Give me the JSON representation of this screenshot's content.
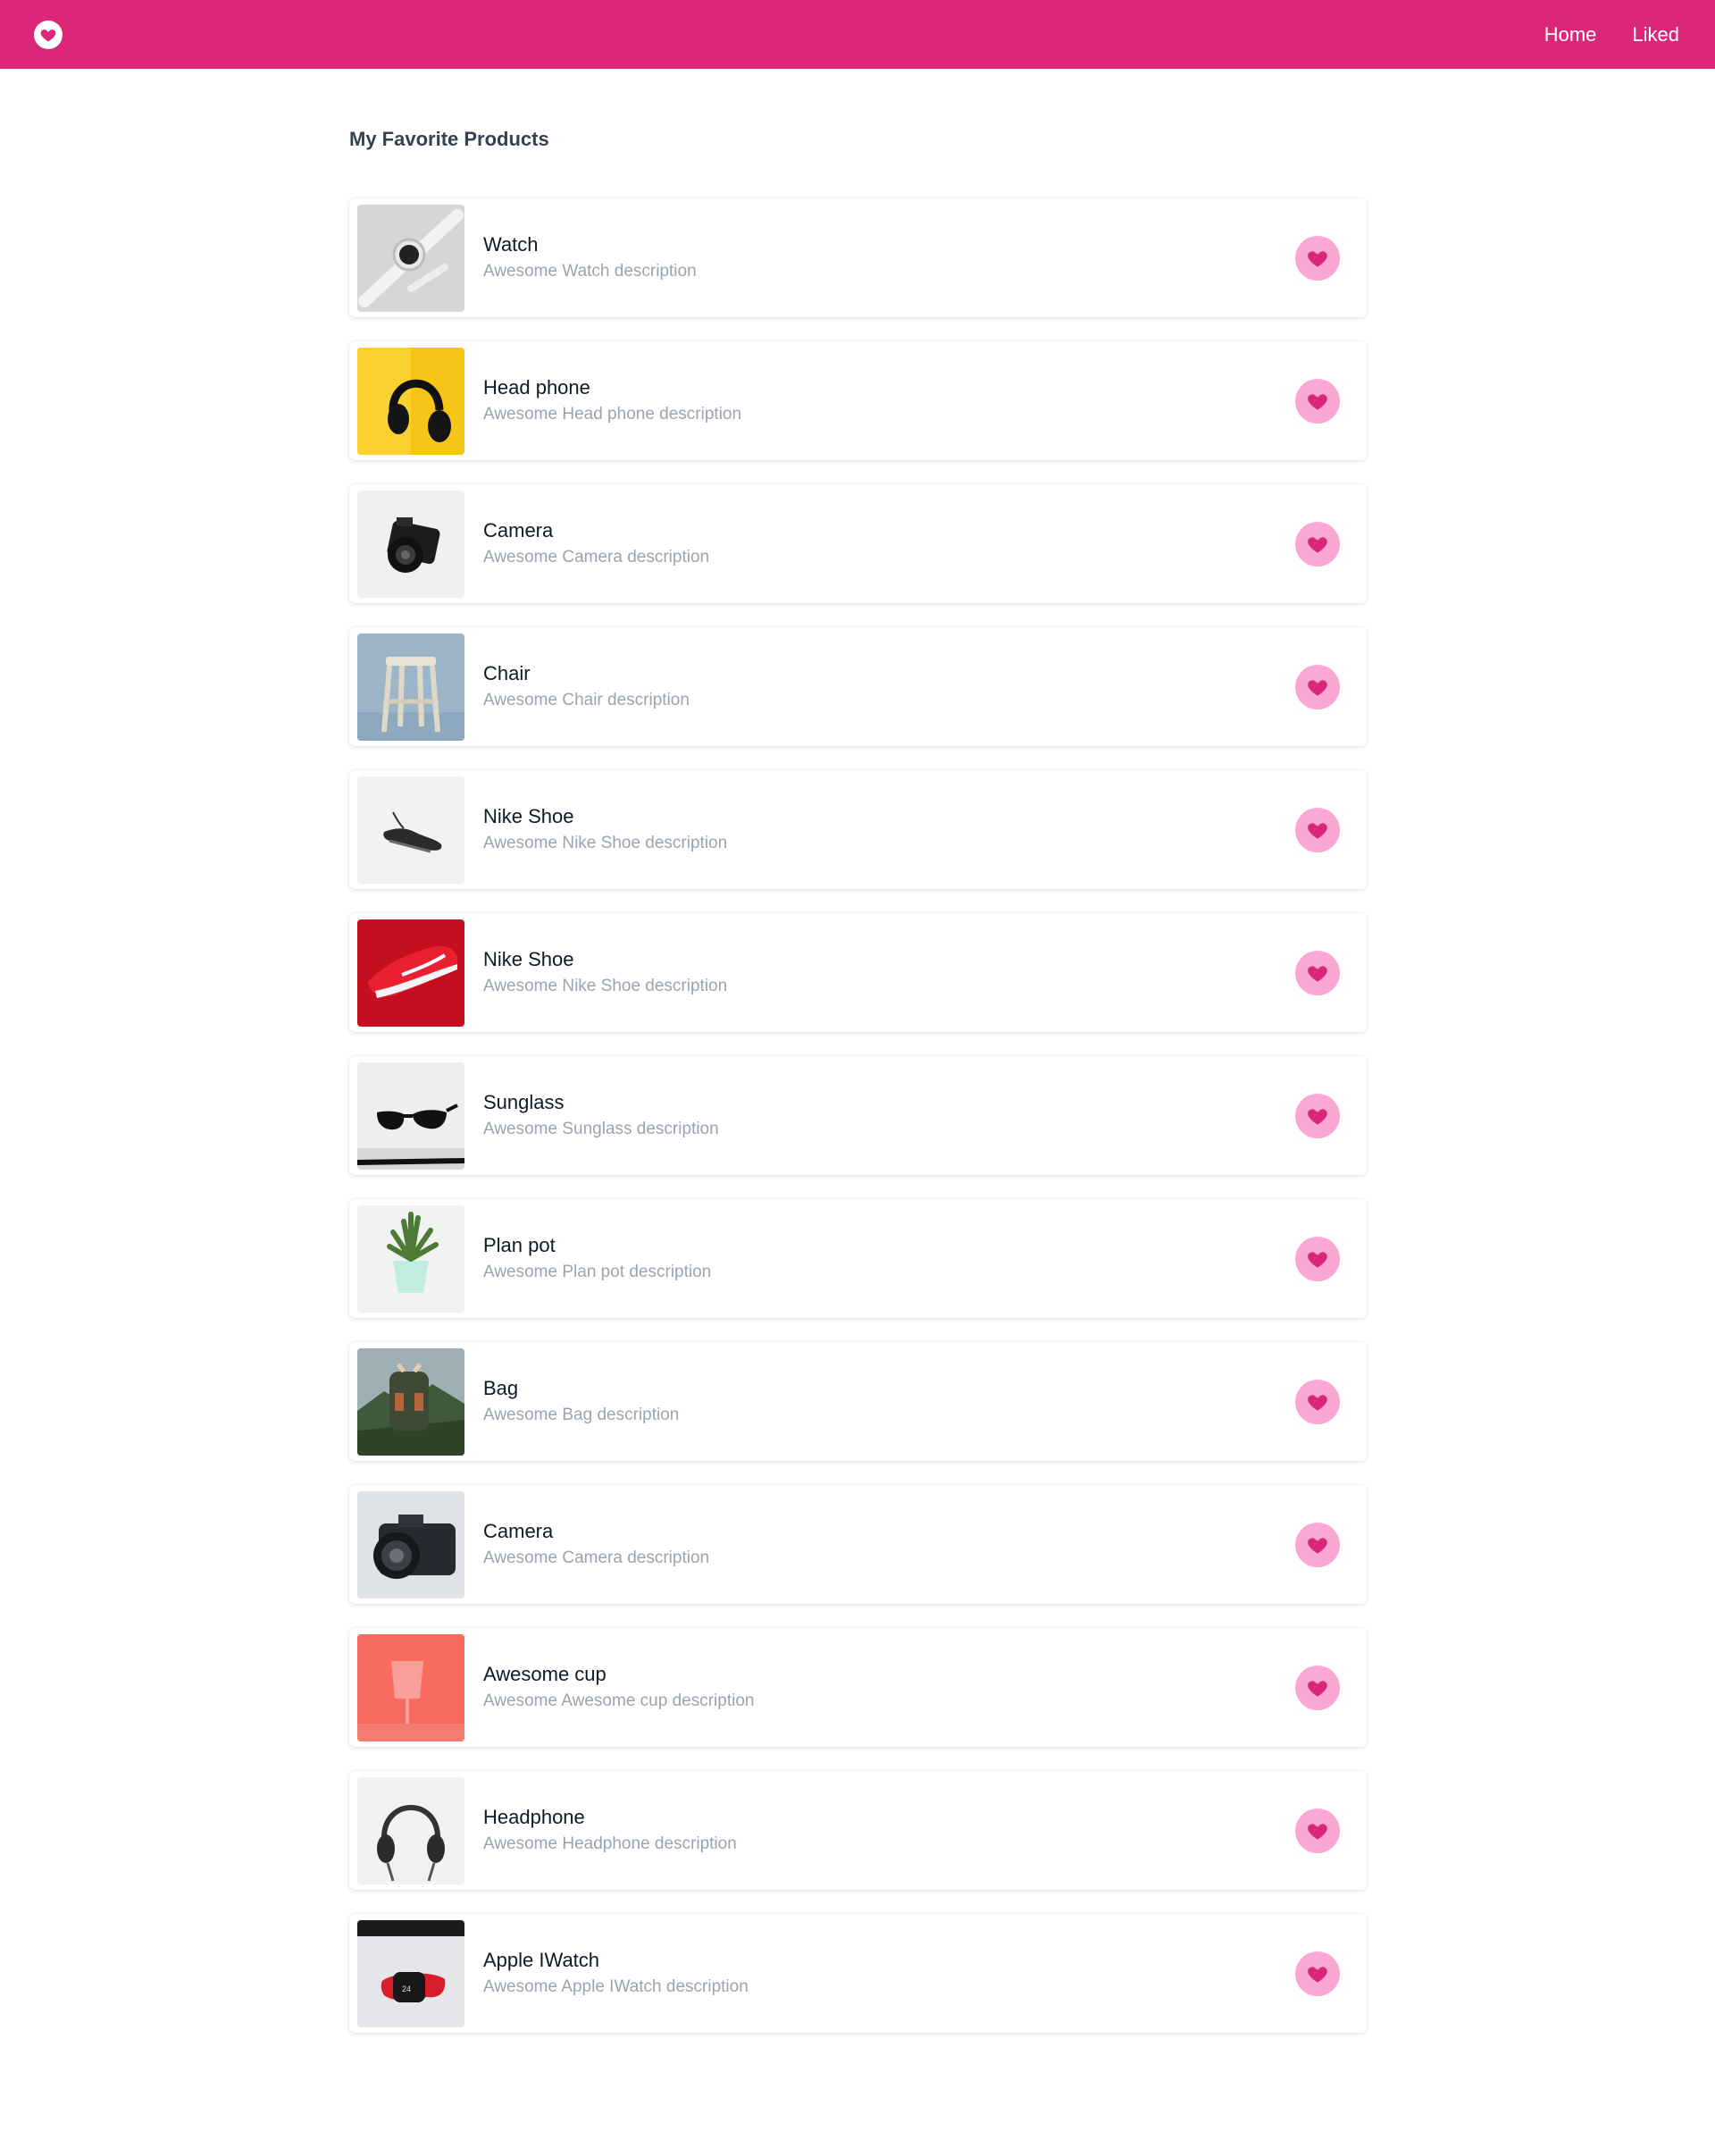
{
  "nav": {
    "logo_icon": "heart-icon",
    "links": [
      "Home",
      "Liked"
    ]
  },
  "colors": {
    "brand": "#db2777",
    "like_bg": "#f9a8d4",
    "like_heart": "#db2777"
  },
  "page": {
    "title": "My Favorite Products"
  },
  "products": [
    {
      "name": "Watch",
      "description": "Awesome Watch description",
      "image": "smartwatch-with-white-strap"
    },
    {
      "name": "Head phone",
      "description": "Awesome Head phone description",
      "image": "black-headphones-on-yellow"
    },
    {
      "name": "Camera",
      "description": "Awesome Camera description",
      "image": "black-camera-on-white"
    },
    {
      "name": "Chair",
      "description": "Awesome Chair description",
      "image": "wooden-stool-on-blue"
    },
    {
      "name": "Nike Shoe",
      "description": "Awesome Nike Shoe description",
      "image": "black-sneaker-on-white"
    },
    {
      "name": "Nike Shoe",
      "description": "Awesome Nike Shoe description",
      "image": "red-sneaker-on-red"
    },
    {
      "name": "Sunglass",
      "description": "Awesome Sunglass description",
      "image": "black-sunglasses"
    },
    {
      "name": "Plan pot",
      "description": "Awesome Plan pot description",
      "image": "succulent-in-mint-pot"
    },
    {
      "name": "Bag",
      "description": "Awesome Bag description",
      "image": "backpack-in-mountains"
    },
    {
      "name": "Camera",
      "description": "Awesome Camera description",
      "image": "dslr-camera-grey"
    },
    {
      "name": "Awesome cup",
      "description": "Awesome Awesome cup description",
      "image": "pink-cup-on-coral"
    },
    {
      "name": "Headphone",
      "description": "Awesome Headphone description",
      "image": "grey-headphones-on-white"
    },
    {
      "name": "Apple IWatch",
      "description": "Awesome Apple IWatch description",
      "image": "red-apple-watch"
    }
  ],
  "like_icon": "heart-icon"
}
